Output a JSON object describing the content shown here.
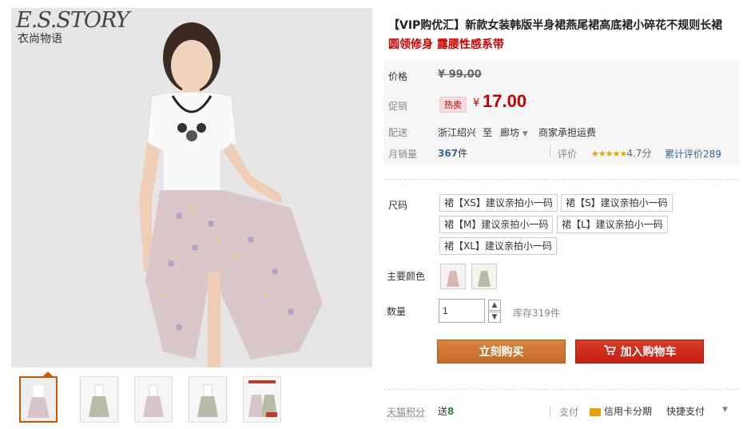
{
  "brand": {
    "en": "E.S.STORY",
    "cn": "衣尚物语"
  },
  "product": {
    "title": "【VIP购优汇】新款女装韩版半身裙燕尾裙高底裙小碎花不规则长裙",
    "subtitle": "圆领修身 露腰性感系带"
  },
  "price": {
    "label": "价格",
    "original": "¥ 99.00",
    "promo_label": "促销",
    "hot_badge": "热卖",
    "currency": "¥",
    "promo_value": "17.00"
  },
  "shipping": {
    "label": "配送",
    "from": "浙江绍兴",
    "to_word": "至",
    "dest": "廊坊",
    "fee": "商家承担运费"
  },
  "sales": {
    "label": "月销量",
    "count": "367",
    "unit": "件",
    "rating_label": "评价",
    "stars": "★★★★★",
    "score": "4.7分",
    "total_reviews": "累计评价289"
  },
  "sku": {
    "size_label": "尺码",
    "sizes": [
      "裙【XS】建议亲拍小一码",
      "裙【S】建议亲拍小一码",
      "裙【M】建议亲拍小一码",
      "裙【L】建议亲拍小一码",
      "裙【XL】建议亲拍小一码"
    ],
    "color_label": "主要颜色",
    "qty_label": "数量",
    "qty_value": "1",
    "stock": "库存319件"
  },
  "actions": {
    "buy_now": "立刻购买",
    "add_to_cart": "加入购物车"
  },
  "footer": {
    "points_label": "天猫积分",
    "points_value": "送",
    "points_num": "8",
    "pay_label": "支付",
    "card_pay": "信用卡分期",
    "quick_pay": "快捷支付"
  },
  "colors": {
    "accent_red": "#c40000",
    "buy_orange": "#c46a28"
  }
}
